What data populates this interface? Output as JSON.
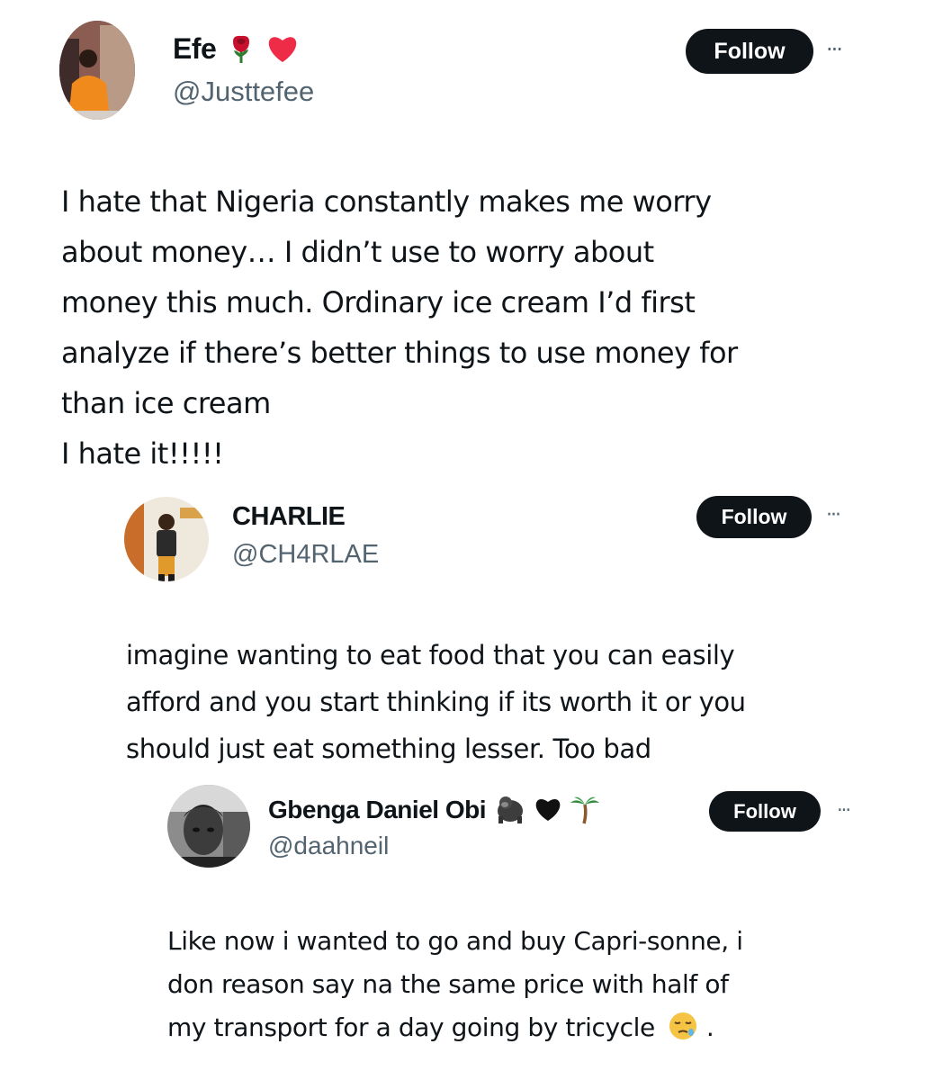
{
  "tweets": [
    {
      "name": "Efe",
      "handle": "@Justtefee",
      "name_emojis": [
        "rose-icon",
        "red-heart-icon"
      ],
      "follow_label": "Follow",
      "more_label": "···",
      "body_lines": [
        "I hate that Nigeria constantly makes me worry",
        "about money… I didn’t use to worry about",
        "money this much. Ordinary ice cream I’d first",
        "analyze if there’s better things to use money for",
        "than ice cream",
        "I hate it!!!!!"
      ]
    },
    {
      "name": "CHARLIE",
      "handle": "@CH4RLAE",
      "follow_label": "Follow",
      "more_label": "···",
      "body_lines": [
        "imagine wanting to eat food that you can easily",
        "afford and you start thinking if its worth it or you",
        "should just eat something lesser. Too bad"
      ]
    },
    {
      "name": "Gbenga Daniel Obi",
      "handle": "@daahneil",
      "name_emojis": [
        "gorilla-icon",
        "black-heart-icon",
        "palm-tree-icon"
      ],
      "follow_label": "Follow",
      "more_label": "···",
      "body_lines": [
        "Like now i wanted to go and buy Capri-sonne, i",
        "don reason say na the same price with half of",
        "my transport for a day going by tricycle",
        "."
      ],
      "end_emoji": "sleepy-face-icon"
    }
  ],
  "colors": {
    "text": "#0f1419",
    "secondary": "#536471",
    "button_bg": "#0f1419",
    "button_text": "#ffffff",
    "rose": "#c8102e",
    "heart": "#e0245e"
  }
}
